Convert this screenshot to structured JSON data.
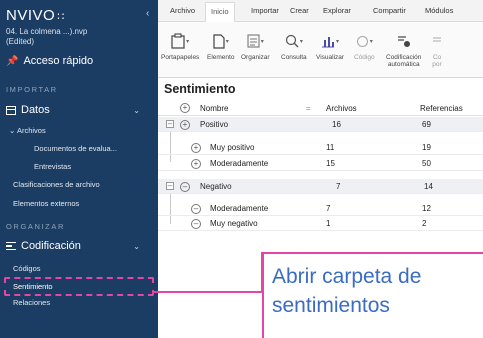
{
  "app": {
    "logo": "NVIVO",
    "logo_mark": "∷",
    "project": "04. La colmena ...).nvp",
    "project_state": "(Edited)"
  },
  "sidebar": {
    "collapse_glyph": "‹",
    "quick_access": "Acceso rápido",
    "importar": "IMPORTAR",
    "datos": "Datos",
    "archivos": "Archivos",
    "documentos": "Documentos de evalua...",
    "entrevistas": "Entrevistas",
    "clasificaciones": "Clasificaciones de archivo",
    "externos": "Elementos externos",
    "organizar": "ORGANIZAR",
    "codificacion": "Codificación",
    "codigos": "Códigos",
    "sentimiento": "Sentimiento",
    "relaciones": "Relaciones"
  },
  "ribbon": {
    "tabs": [
      "Archivo",
      "Inicio",
      "Importar",
      "Crear",
      "Explorar",
      "Compartir",
      "Módulos"
    ],
    "active_tab": "Inicio",
    "buttons": {
      "portapapeles": "Portapapeles",
      "elemento": "Elemento",
      "organizar": "Organizar",
      "consulta": "Consulta",
      "visualizar": "Visualizar",
      "codigo": "Código",
      "codificacion": "Codificación",
      "automatica": "automática",
      "co": "Co",
      "por": "por"
    }
  },
  "content": {
    "title": "Sentimiento",
    "columns": {
      "nombre": "Nombre",
      "archivos": "Archivos",
      "referencias": "Referencias"
    },
    "rows": [
      {
        "name": "Positivo",
        "archivos": "16",
        "referencias": "69"
      },
      {
        "name": "Muy positivo",
        "archivos": "11",
        "referencias": "19"
      },
      {
        "name": "Moderadamente",
        "archivos": "15",
        "referencias": "50"
      },
      {
        "name": "Negativo",
        "archivos": "7",
        "referencias": "14"
      },
      {
        "name": "Moderadamente",
        "archivos": "7",
        "referencias": "12"
      },
      {
        "name": "Muy negativo",
        "archivos": "1",
        "referencias": "2"
      }
    ]
  },
  "callout": {
    "line1": "Abrir carpeta de",
    "line2": "sentimientos"
  },
  "colors": {
    "sidebar": "#1c3d63",
    "highlight": "#e645a6",
    "callout_text": "#3a6cc4"
  }
}
